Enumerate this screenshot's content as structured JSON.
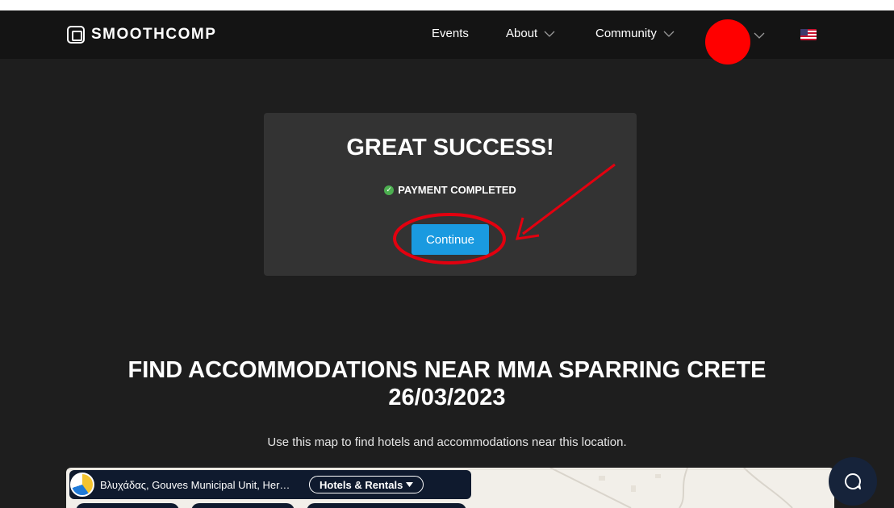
{
  "header": {
    "logo_text": "SMOOTHCOMP",
    "nav": [
      {
        "label": "Events"
      },
      {
        "label": "About"
      },
      {
        "label": "Community"
      }
    ]
  },
  "success_card": {
    "title": "GREAT SUCCESS!",
    "status": "PAYMENT COMPLETED",
    "button_label": "Continue"
  },
  "accommodation": {
    "title_line1": "FIND ACCOMMODATIONS NEAR MMA SPARRING CRETE",
    "title_line2": "26/03/2023",
    "subtitle": "Use this map to find hotels and accommodations near this location."
  },
  "map": {
    "location_text": "Βλυχάδας, Gouves Municipal Unit, Her…",
    "filter_label": "Hotels & Rentals"
  },
  "colors": {
    "background": "#1e1e1e",
    "navbar": "#141414",
    "card": "#333333",
    "button": "#1a9ae0",
    "annotation": "#e3000f",
    "avatar": "#ff0000"
  }
}
